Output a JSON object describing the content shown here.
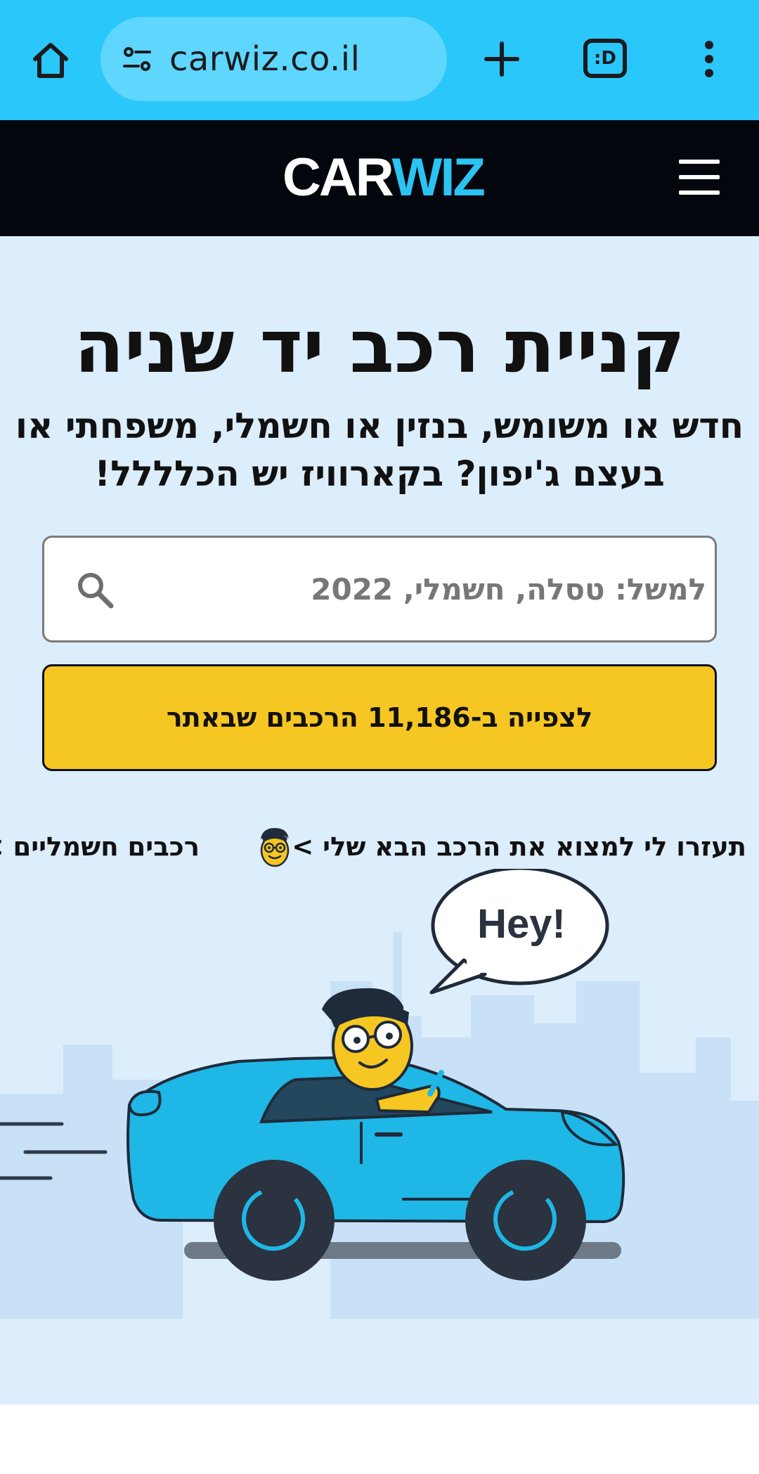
{
  "browser": {
    "url": "carwiz.co.il",
    "tabs_label": ":D"
  },
  "site": {
    "logo_car": "CAR",
    "logo_wiz": "WIZ"
  },
  "hero": {
    "title": "קניית רכב יד שניה",
    "subtitle": "חדש או משומש, בנזין או חשמלי, משפחתי או בעצם ג'יפון? בקארוויז יש הכלללל!",
    "search_placeholder": "למשל: טסלה, חשמלי, 2022",
    "cta_label": "לצפייה ב-11,186 הרכבים שבאתר"
  },
  "chips": {
    "help_label": "תעזרו לי למצוא את הרכב הבא שלי >",
    "ev_label": "רכבים חשמליים >"
  },
  "illustration": {
    "speech_text": "Hey!"
  },
  "colors": {
    "browser_bar": "#2ac7fb",
    "header_bg": "#03060d",
    "brand_blue": "#2bc3f2",
    "hero_bg": "#dcedfb",
    "cta_yellow": "#f6c622"
  }
}
